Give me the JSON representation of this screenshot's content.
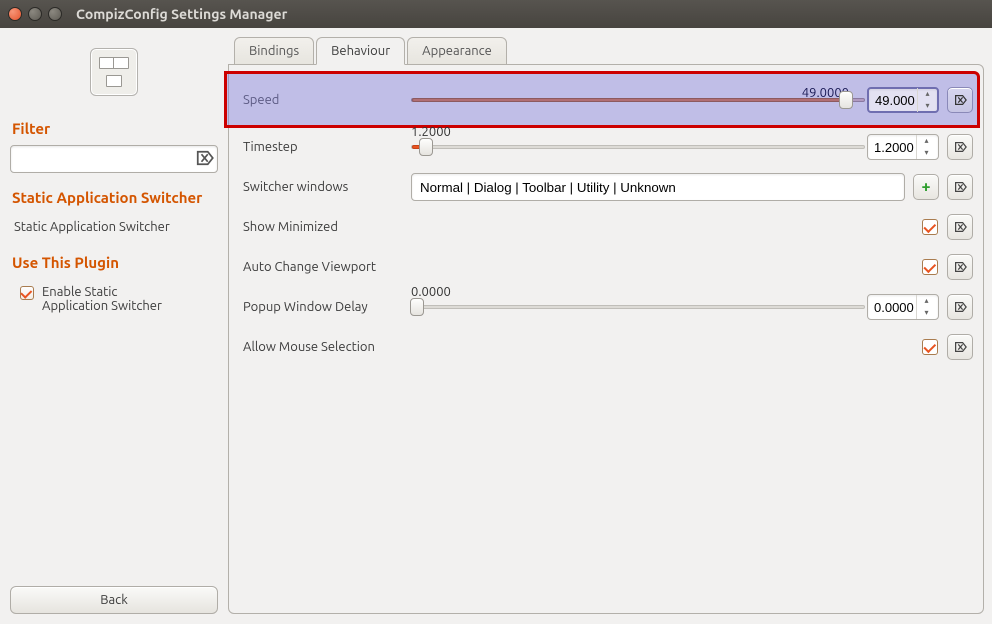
{
  "window": {
    "title": "CompizConfig Settings Manager"
  },
  "sidebar": {
    "filter_heading": "Filter",
    "filter_value": "",
    "plugin_heading": "Static Application Switcher",
    "plugin_link": "Static Application Switcher",
    "use_heading": "Use This Plugin",
    "enable_label": "Enable Static Application Switcher",
    "enable_checked": true,
    "back_label": "Back"
  },
  "tabs": {
    "bindings": "Bindings",
    "behaviour": "Behaviour",
    "appearance": "Appearance",
    "active": "behaviour"
  },
  "settings": {
    "speed": {
      "label": "Speed",
      "value": "49.0000",
      "display": "49.0000",
      "pct": 96
    },
    "timestep": {
      "label": "Timestep",
      "value": "1.2000",
      "display": "1.2000",
      "pct": 3
    },
    "switcher_windows": {
      "label": "Switcher windows",
      "value": "Normal | Dialog | Toolbar | Utility | Unknown"
    },
    "show_min": {
      "label": "Show Minimized",
      "checked": true
    },
    "auto_vp": {
      "label": "Auto Change Viewport",
      "checked": true
    },
    "popup_delay": {
      "label": "Popup Window Delay",
      "value": "0.0000",
      "display": "0.0000",
      "pct": 0
    },
    "allow_mouse": {
      "label": "Allow Mouse Selection",
      "checked": true
    }
  }
}
